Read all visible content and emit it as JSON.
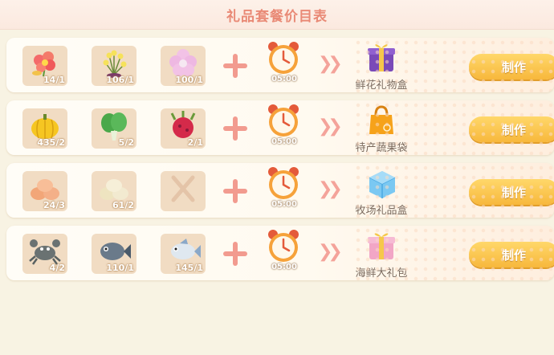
{
  "title": "礼品套餐价目表",
  "rows": [
    {
      "ingredients": [
        {
          "icon": "flower-icon",
          "qty": "14/1"
        },
        {
          "icon": "yellow-flower-icon",
          "qty": "106/1"
        },
        {
          "icon": "pink-flower-icon",
          "qty": "100/1"
        }
      ],
      "time": "05:00",
      "product": {
        "icon": "gift-box-icon",
        "name": "鲜花礼物盒"
      },
      "button": "制作"
    },
    {
      "ingredients": [
        {
          "icon": "pumpkin-icon",
          "qty": "435/2"
        },
        {
          "icon": "cabbage-icon",
          "qty": "5/2"
        },
        {
          "icon": "dragonfruit-icon",
          "qty": "2/1"
        }
      ],
      "time": "05:00",
      "product": {
        "icon": "bag-icon",
        "name": "特产蔬果袋"
      },
      "button": "制作"
    },
    {
      "ingredients": [
        {
          "icon": "eggs-icon",
          "qty": "24/3"
        },
        {
          "icon": "duck-eggs-icon",
          "qty": "61/2"
        },
        {
          "icon": "empty-slot-icon",
          "qty": ""
        }
      ],
      "time": "05:00",
      "product": {
        "icon": "blue-box-icon",
        "name": "牧场礼品盒"
      },
      "button": "制作"
    },
    {
      "ingredients": [
        {
          "icon": "crab-icon",
          "qty": "4/2"
        },
        {
          "icon": "fish-icon",
          "qty": "110/1"
        },
        {
          "icon": "white-fish-icon",
          "qty": "145/1"
        }
      ],
      "time": "05:00",
      "product": {
        "icon": "pink-gift-icon",
        "name": "海鲜大礼包"
      },
      "button": "制作"
    }
  ]
}
